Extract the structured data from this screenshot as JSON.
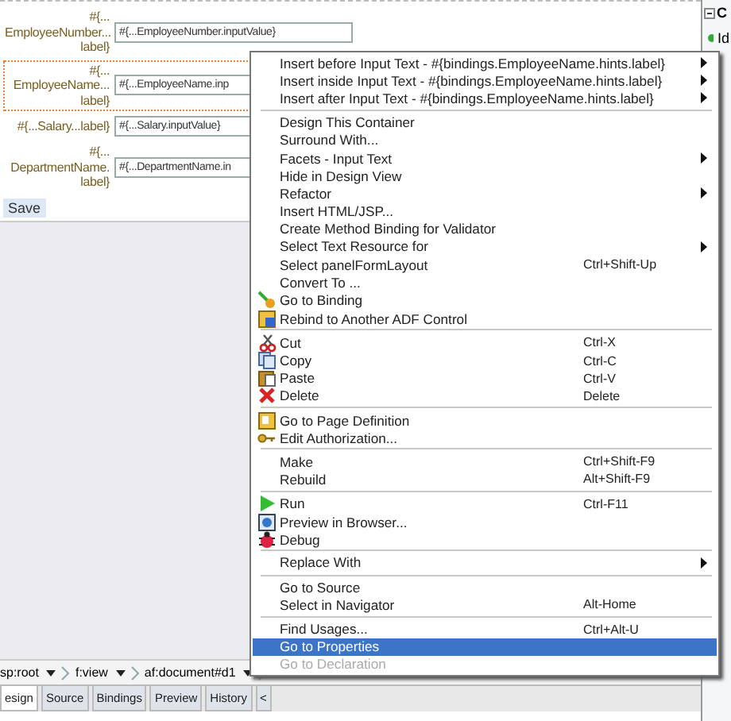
{
  "form": {
    "rows": [
      {
        "label": "#{...\nEmployeeNumber...\nlabel}",
        "value": "#{...EmployeeNumber.inputValue}",
        "selected": false
      },
      {
        "label": "#{...\nEmployeeName...\nlabel}",
        "value": "#{...EmployeeName.inp",
        "selected": true
      },
      {
        "label": "#{...Salary...label}",
        "value": "#{...Salary.inputValue}",
        "selected": false
      },
      {
        "label": "#{...\nDepartmentName.\nlabel}",
        "value": "#{...DepartmentName.in",
        "selected": false
      }
    ],
    "button": "Save"
  },
  "breadcrumb": [
    "sp:root",
    "f:view",
    "af:document#d1"
  ],
  "tabs": [
    {
      "label": "esign",
      "selected": true
    },
    {
      "label": "Source",
      "selected": false
    },
    {
      "label": "Bindings",
      "selected": false
    },
    {
      "label": "Preview",
      "selected": false
    },
    {
      "label": "History",
      "selected": false
    }
  ],
  "tab_scroll": "<",
  "side_panel": {
    "header": "C",
    "item": "Id"
  },
  "menu": [
    [
      {
        "label": "Insert before Input Text - #{bindings.EmployeeName.hints.label}",
        "submenu": true,
        "selected": false,
        "disabled": false
      },
      {
        "label": "Insert inside Input Text - #{bindings.EmployeeName.hints.label}",
        "submenu": true,
        "selected": false,
        "disabled": false
      },
      {
        "label": "Insert after Input Text - #{bindings.EmployeeName.hints.label}",
        "submenu": true,
        "selected": false,
        "disabled": false
      }
    ],
    [
      {
        "label": "Design This Container",
        "submenu": false,
        "selected": false,
        "disabled": false
      },
      {
        "label": "Surround With...",
        "submenu": false,
        "selected": false,
        "disabled": false
      },
      {
        "label": "Facets - Input Text",
        "submenu": true,
        "selected": false,
        "disabled": false
      },
      {
        "label": "Hide in Design View",
        "submenu": false,
        "selected": false,
        "disabled": false
      },
      {
        "label": "Refactor",
        "submenu": true,
        "selected": false,
        "disabled": false
      },
      {
        "label": "Insert HTML/JSP...",
        "submenu": false,
        "selected": false,
        "disabled": false
      },
      {
        "label": "Create Method Binding for Validator",
        "submenu": false,
        "selected": false,
        "disabled": false
      },
      {
        "label": "Select Text Resource for",
        "submenu": true,
        "selected": false,
        "disabled": false
      },
      {
        "label": "Select panelFormLayout",
        "shortcut": "Ctrl+Shift-Up",
        "submenu": false,
        "selected": false,
        "disabled": false
      },
      {
        "label": "Convert To ...",
        "submenu": false,
        "selected": false,
        "disabled": false
      },
      {
        "label": "Go to Binding",
        "kind": "binding",
        "submenu": false,
        "selected": false,
        "disabled": false
      },
      {
        "label": "Rebind to Another ADF Control",
        "kind": "rebind",
        "submenu": false,
        "selected": false,
        "disabled": false
      }
    ],
    [
      {
        "label": "Cut",
        "shortcut": "Ctrl-X",
        "kind": "scissors",
        "submenu": false,
        "selected": false,
        "disabled": false
      },
      {
        "label": "Copy",
        "shortcut": "Ctrl-C",
        "kind": "copy",
        "submenu": false,
        "selected": false,
        "disabled": false
      },
      {
        "label": "Paste",
        "shortcut": "Ctrl-V",
        "kind": "paste",
        "submenu": false,
        "selected": false,
        "disabled": false
      },
      {
        "label": "Delete",
        "shortcut": "Delete",
        "kind": "delete",
        "submenu": false,
        "selected": false,
        "disabled": false
      }
    ],
    [
      {
        "label": "Go to Page Definition",
        "kind": "page",
        "submenu": false,
        "selected": false,
        "disabled": false
      },
      {
        "label": "Edit Authorization...",
        "kind": "key",
        "submenu": false,
        "selected": false,
        "disabled": false
      }
    ],
    [
      {
        "label": "Make",
        "shortcut": "Ctrl+Shift-F9",
        "submenu": false,
        "selected": false,
        "disabled": false
      },
      {
        "label": "Rebuild",
        "shortcut": "Alt+Shift-F9",
        "submenu": false,
        "selected": false,
        "disabled": false
      }
    ],
    [
      {
        "label": "Run",
        "shortcut": "Ctrl-F11",
        "kind": "run",
        "submenu": false,
        "selected": false,
        "disabled": false
      },
      {
        "label": "Preview in Browser...",
        "kind": "browser",
        "submenu": false,
        "selected": false,
        "disabled": false
      },
      {
        "label": "Debug",
        "kind": "bug",
        "submenu": false,
        "selected": false,
        "disabled": false
      }
    ],
    [
      {
        "label": "Replace With",
        "submenu": true,
        "selected": false,
        "disabled": false
      }
    ],
    [
      {
        "label": "Go to Source",
        "submenu": false,
        "selected": false,
        "disabled": false
      },
      {
        "label": "Select in Navigator",
        "shortcut": "Alt-Home",
        "submenu": false,
        "selected": false,
        "disabled": false
      }
    ],
    [
      {
        "label": "Find Usages...",
        "shortcut": "Ctrl+Alt-U",
        "submenu": false,
        "selected": false,
        "disabled": false
      },
      {
        "label": "Go to Properties",
        "submenu": false,
        "selected": true,
        "disabled": false
      },
      {
        "label": "Go to Declaration",
        "submenu": false,
        "selected": false,
        "disabled": true
      }
    ]
  ]
}
